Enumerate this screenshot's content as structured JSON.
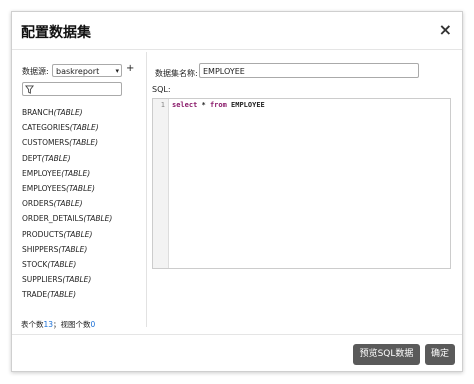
{
  "dialog": {
    "title": "配置数据集",
    "close_symbol": "×"
  },
  "datasource": {
    "label": "数据源:",
    "selected": "baskreport",
    "add_symbol": "+"
  },
  "filter": {
    "value": "",
    "icon": "filter-icon"
  },
  "tables": [
    {
      "name": "BRANCH",
      "type": "(TABLE)"
    },
    {
      "name": "CATEGORIES",
      "type": "(TABLE)"
    },
    {
      "name": "CUSTOMERS",
      "type": "(TABLE)"
    },
    {
      "name": "DEPT",
      "type": "(TABLE)"
    },
    {
      "name": "EMPLOYEE",
      "type": "(TABLE)"
    },
    {
      "name": "EMPLOYEES",
      "type": "(TABLE)"
    },
    {
      "name": "ORDERS",
      "type": "(TABLE)"
    },
    {
      "name": "ORDER_DETAILS",
      "type": "(TABLE)"
    },
    {
      "name": "PRODUCTS",
      "type": "(TABLE)"
    },
    {
      "name": "SHIPPERS",
      "type": "(TABLE)"
    },
    {
      "name": "STOCK",
      "type": "(TABLE)"
    },
    {
      "name": "SUPPLIERS",
      "type": "(TABLE)"
    },
    {
      "name": "TRADE",
      "type": "(TABLE)"
    }
  ],
  "counts": {
    "table_label": "表个数",
    "table_count": "13",
    "separator": "；",
    "view_label": "视图个数",
    "view_count": "0"
  },
  "dataset": {
    "name_label": "数据集名称:",
    "name_value": "EMPLOYEE",
    "sql_label": "SQL:",
    "line_number": "1",
    "sql_kw1": "select",
    "sql_star": " * ",
    "sql_kw2": "from",
    "sql_table": " EMPLOYEE"
  },
  "buttons": {
    "preview": "预览SQL数据",
    "ok": "确定"
  }
}
